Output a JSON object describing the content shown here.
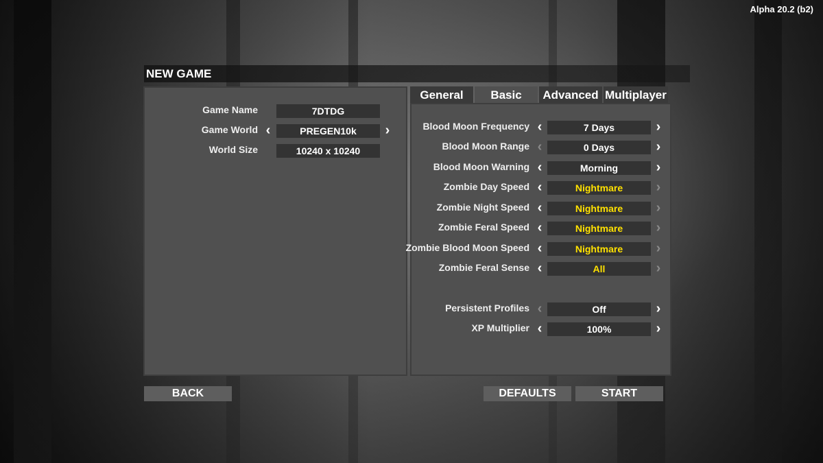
{
  "version": "Alpha 20.2 (b2)",
  "title": "NEW GAME",
  "left_panel": {
    "game_name_label": "Game Name",
    "game_name_value": "7DTDG",
    "game_world_label": "Game World",
    "game_world_value": "PREGEN10k",
    "world_size_label": "World Size",
    "world_size_value": "10240 x 10240"
  },
  "tabs": {
    "general": "General",
    "basic": "Basic",
    "advanced": "Advanced",
    "multiplayer": "Multiplayer",
    "active": "Basic"
  },
  "settings": [
    {
      "label": "Blood Moon Frequency",
      "value": "7 Days",
      "highlight": false,
      "left_enabled": true,
      "right_enabled": true
    },
    {
      "label": "Blood Moon Range",
      "value": "0 Days",
      "highlight": false,
      "left_enabled": false,
      "right_enabled": true
    },
    {
      "label": "Blood Moon Warning",
      "value": "Morning",
      "highlight": false,
      "left_enabled": true,
      "right_enabled": true
    },
    {
      "label": "Zombie Day Speed",
      "value": "Nightmare",
      "highlight": true,
      "left_enabled": true,
      "right_enabled": false
    },
    {
      "label": "Zombie Night Speed",
      "value": "Nightmare",
      "highlight": true,
      "left_enabled": true,
      "right_enabled": false
    },
    {
      "label": "Zombie Feral Speed",
      "value": "Nightmare",
      "highlight": true,
      "left_enabled": true,
      "right_enabled": false
    },
    {
      "label": "Zombie Blood Moon Speed",
      "value": "Nightmare",
      "highlight": true,
      "left_enabled": true,
      "right_enabled": false
    },
    {
      "label": "Zombie Feral Sense",
      "value": "All",
      "highlight": true,
      "left_enabled": true,
      "right_enabled": false
    },
    {
      "label": "Persistent Profiles",
      "value": "Off",
      "highlight": false,
      "left_enabled": false,
      "right_enabled": true
    },
    {
      "label": "XP Multiplier",
      "value": "100%",
      "highlight": false,
      "left_enabled": true,
      "right_enabled": true
    }
  ],
  "buttons": {
    "back": "BACK",
    "defaults": "DEFAULTS",
    "start": "START"
  },
  "colors": {
    "highlight_value": "#ffe100",
    "panel": "#505050",
    "field": "#333333"
  },
  "icons": {
    "left_arrow": "‹",
    "right_arrow": "›"
  }
}
